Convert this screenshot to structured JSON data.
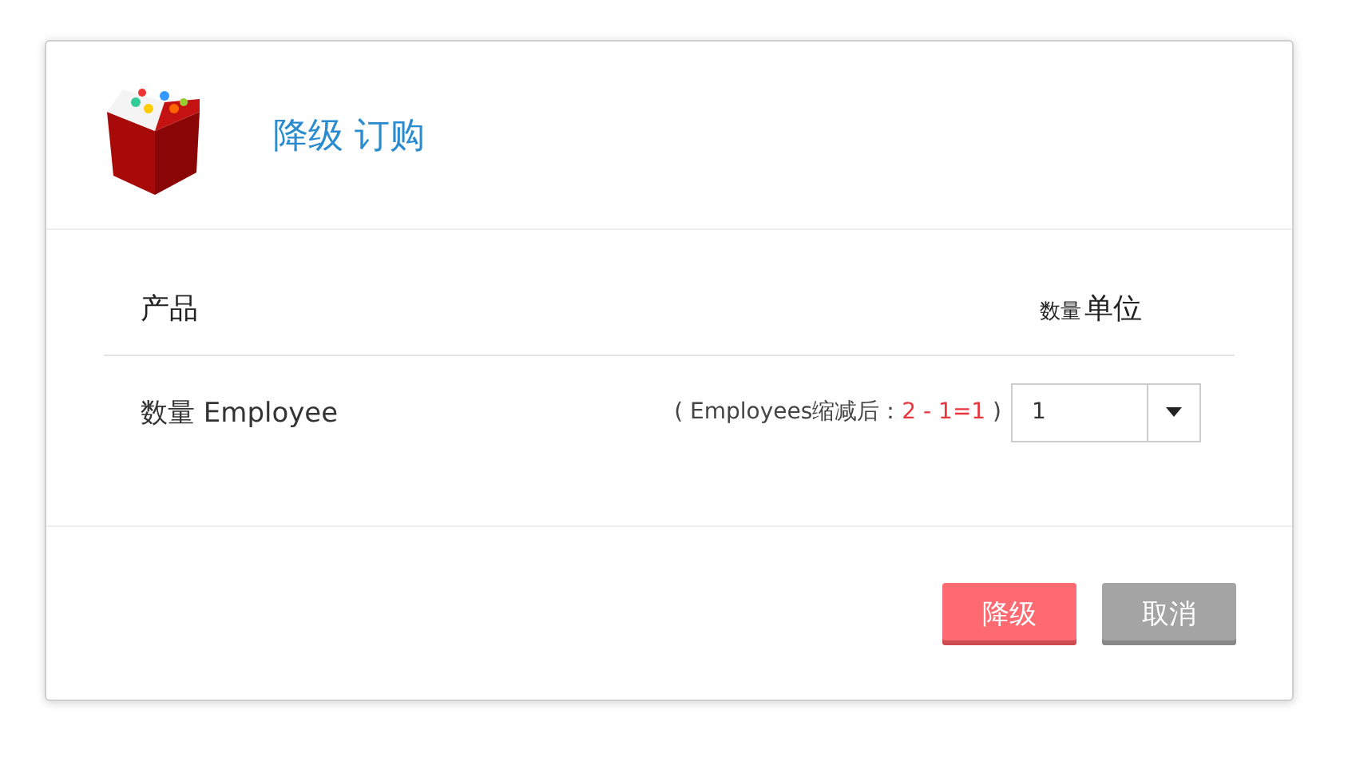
{
  "dialog": {
    "title": "降级 订购",
    "columns": [
      {
        "kind": "product",
        "label": "产品"
      },
      {
        "kind": "quantity",
        "prefix": "数量",
        "label": "单位"
      }
    ],
    "rows": [
      {
        "product": "数量 Employee",
        "note_open": "( Employees缩减后：",
        "note_formula": "2 - 1=1",
        "note_close": ")",
        "quantity": "1"
      }
    ],
    "buttons": [
      {
        "kind": "primary",
        "label": "降级"
      },
      {
        "kind": "secondary",
        "label": "取消"
      }
    ]
  }
}
